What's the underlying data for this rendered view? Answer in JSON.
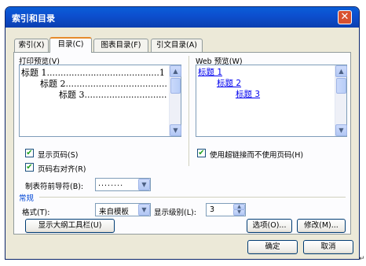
{
  "dialog": {
    "title": "索引和目录",
    "close_glyph": "✕"
  },
  "tabs": [
    {
      "label": "索引(X)"
    },
    {
      "label": "目录(C)"
    },
    {
      "label": "图表目录(F)"
    },
    {
      "label": "引文目录(A)"
    }
  ],
  "print_preview": {
    "label": "打印预览(V)",
    "lines": [
      {
        "text": "标题 1.........................................1"
      },
      {
        "text": "标题 2......................................3"
      },
      {
        "text": "标题 3...............................5"
      }
    ]
  },
  "web_preview": {
    "label": "Web 预览(W)",
    "links": [
      "标题 1",
      "标题 2",
      "标题 3"
    ]
  },
  "options": {
    "show_page_numbers": {
      "label": "显示页码(S)",
      "checked": true
    },
    "right_align_page_numbers": {
      "label": "页码右对齐(R)",
      "checked": true
    },
    "use_hyperlinks": {
      "label": "使用超链接而不使用页码(H)",
      "checked": true
    },
    "tab_leader": {
      "label": "制表符前导符(B):",
      "value": "........"
    }
  },
  "general": {
    "section_label": "常规",
    "format_label": "格式(T):",
    "format_value": "来自模板",
    "levels_label": "显示级别(L):",
    "levels_value": "3"
  },
  "buttons": {
    "outline_toolbar": "显示大纲工具栏(U)",
    "options": "选项(O)...",
    "modify": "修改(M)...",
    "ok": "确定",
    "cancel": "取消"
  },
  "icons": {
    "check": "✔",
    "up": "▲",
    "down": "▼",
    "return_mark": "↵"
  },
  "colors": {
    "titlebar": "#0b4fcf",
    "link": "#0000ee",
    "check": "#21a121",
    "active_tab_accent": "#e68b2c"
  }
}
